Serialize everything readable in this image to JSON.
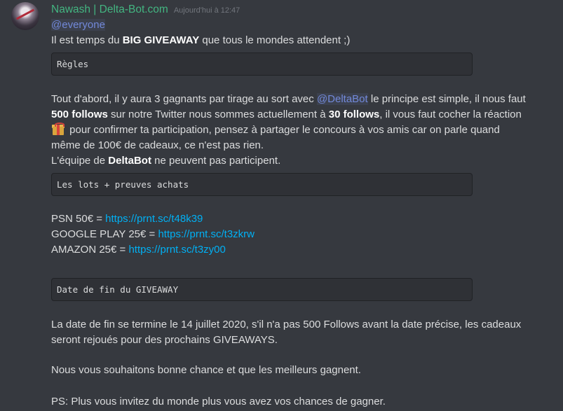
{
  "author": {
    "name": "Nawash | Delta-Bot.com",
    "timestamp": "Aujourd'hui à 12:47"
  },
  "message": {
    "mention_everyone": "@everyone",
    "intro_pre": "Il est temps du ",
    "intro_bold": "BIG GIVEAWAY",
    "intro_post": " que tous le mondes attendent ;)",
    "code_rules": "Règles",
    "p1_a": "Tout d'abord, il y aura 3 gagnants par tirage au sort avec ",
    "p1_mention": "@DeltaBot",
    "p1_b": " le principe est simple, il nous faut",
    "p2_bold1": "500 follows",
    "p2_a": " sur notre Twitter nous sommes actuellement à ",
    "p2_bold2": "30 follows",
    "p2_b": ", il vous faut cocher la réaction",
    "p3_after_emoji": " pour confirmer ta participation, pensez à partager le concours à vos amis car on parle quand",
    "p4": "même de 100€ de cadeaux, ce n'est pas rien.",
    "p5_a": "L'équipe de ",
    "p5_bold": "DeltaBot",
    "p5_b": " ne peuvent pas participent.",
    "code_prizes": "Les lots + preuves achats",
    "prizes": [
      {
        "label": "PSN 50€ = ",
        "url": "https://prnt.sc/t48k39"
      },
      {
        "label": "GOOGLE PLAY 25€ = ",
        "url": "https://prnt.sc/t3zkrw"
      },
      {
        "label": "AMAZON 25€ = ",
        "url": "https://prnt.sc/t3zy00"
      }
    ],
    "code_end": "Date de fin du GIVEAWAY",
    "end_l1": "La date de fin se termine le 14 juillet 2020, s'il n'a pas 500 Follows avant la date précise, les cadeaux",
    "end_l2": "seront rejoués pour des prochains GIVEAWAYS.",
    "good_luck": "Nous vous souhaitons bonne chance et que les meilleurs gagnent.",
    "ps": "PS: Plus vous invitez du monde plus vous avez vos chances de gagner."
  },
  "emoji": "gift-emoji",
  "colors": {
    "background": "#36393f",
    "username": "#43b581",
    "link": "#00b0f4",
    "mention": "#7289da",
    "codeblock": "#2f3136"
  }
}
